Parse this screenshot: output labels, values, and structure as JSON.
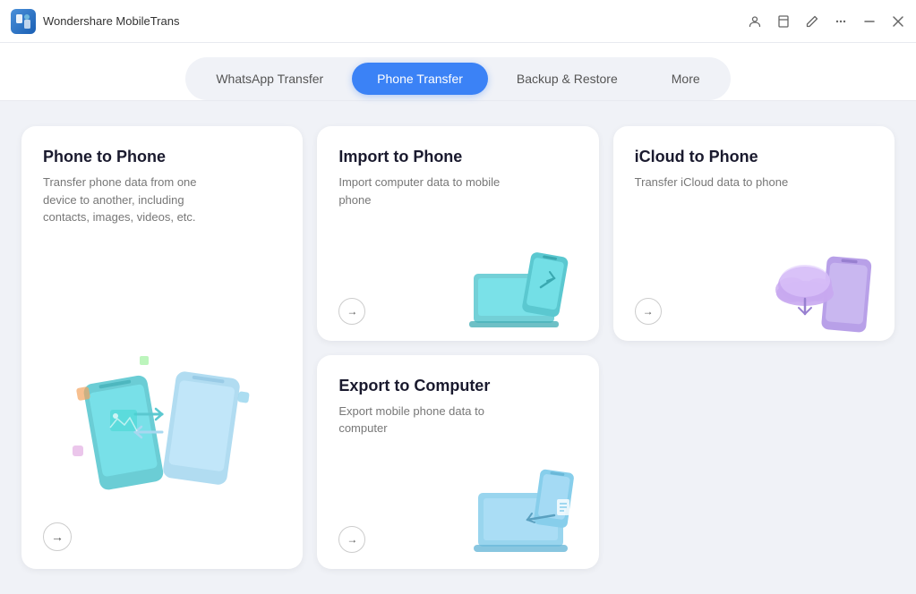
{
  "app": {
    "name": "Wondershare MobileTrans",
    "logo_alt": "MobileTrans Logo"
  },
  "titlebar": {
    "controls": [
      "account",
      "bookmark",
      "edit",
      "menu",
      "minimize",
      "close"
    ]
  },
  "nav": {
    "tabs": [
      {
        "id": "whatsapp",
        "label": "WhatsApp Transfer",
        "active": false
      },
      {
        "id": "phone",
        "label": "Phone Transfer",
        "active": true
      },
      {
        "id": "backup",
        "label": "Backup & Restore",
        "active": false
      },
      {
        "id": "more",
        "label": "More",
        "active": false
      }
    ]
  },
  "cards": [
    {
      "id": "phone-to-phone",
      "title": "Phone to Phone",
      "description": "Transfer phone data from one device to another, including contacts, images, videos, etc.",
      "size": "large",
      "arrow": "→"
    },
    {
      "id": "import-to-phone",
      "title": "Import to Phone",
      "description": "Import computer data to mobile phone",
      "size": "small",
      "arrow": "→"
    },
    {
      "id": "icloud-to-phone",
      "title": "iCloud to Phone",
      "description": "Transfer iCloud data to phone",
      "size": "small",
      "arrow": "→"
    },
    {
      "id": "export-to-computer",
      "title": "Export to Computer",
      "description": "Export mobile phone data to computer",
      "size": "small",
      "arrow": "→"
    }
  ]
}
